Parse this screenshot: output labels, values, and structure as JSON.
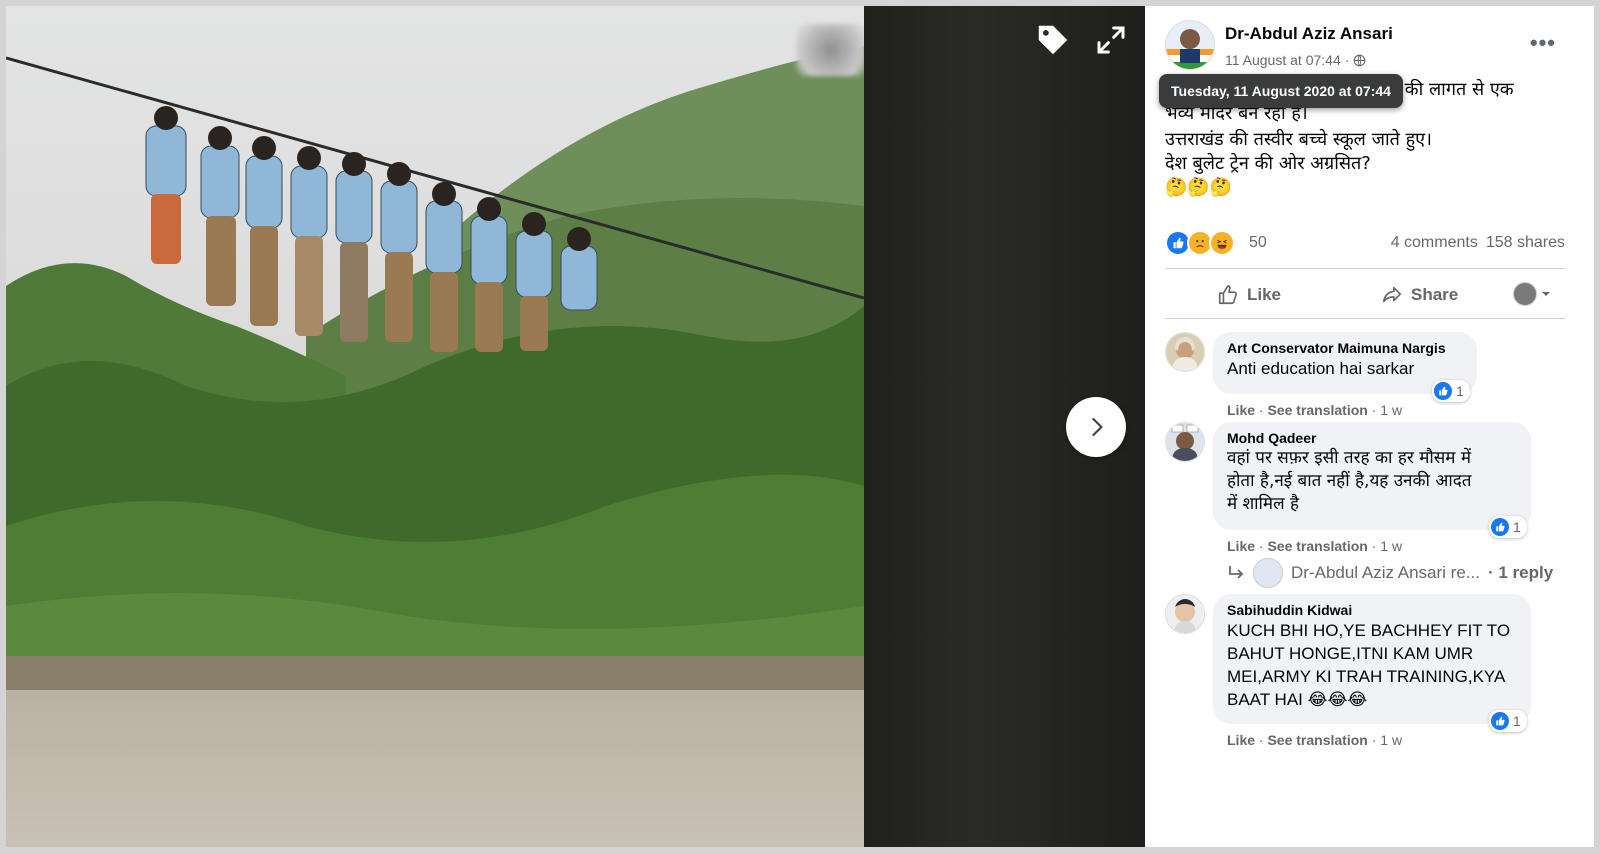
{
  "author": {
    "name": "Dr-Abdul Aziz Ansari",
    "time": "11 August at 07:44 ·",
    "tooltip": "Tuesday, 11 August 2020 at 07:44"
  },
  "post": {
    "lines": [
      "ये तस्वीर उसी देश की है जहां करोड़ों की लागत से एक",
      "भव्य मंदिर बन रहा है।",
      "उत्तराखंड की तस्वीर बच्चे स्कूल जाते हुए।",
      "देश बुलेट ट्रेन की ओर अग्रसित?",
      "🤔🤔🤔"
    ]
  },
  "stats": {
    "reaction_count": "50",
    "comments": "4 comments",
    "shares": "158 shares"
  },
  "actions": {
    "like_label": "Like",
    "share_label": "Share"
  },
  "comments": [
    {
      "name": "Art Conservator Maimuna Nargis",
      "text": [
        "Anti education hai sarkar"
      ],
      "like": "Like",
      "translate": "See translation",
      "age": "1 w",
      "likes": "1"
    },
    {
      "name": "Mohd Qadeer",
      "text": [
        "वहां पर सफ़र इसी तरह का हर मौसम में",
        "होता है,नई बात नहीं है,यह उनकी आदत",
        "में शामिल है"
      ],
      "like": "Like",
      "translate": "See translation",
      "age": "1 w",
      "likes": "1"
    },
    {
      "name": "Sabihuddin Kidwai",
      "text": [
        "KUCH BHI HO,YE BACHHEY FIT TO",
        "BAHUT HONGE,ITNI KAM UMR",
        "MEI,ARMY KI TRAH TRAINING,KYA",
        "BAAT HAI 😂😂😂"
      ],
      "like": "Like",
      "translate": "See translation",
      "age": "1 w",
      "likes": "1"
    }
  ],
  "reply": {
    "text": "Dr-Abdul Aziz Ansari re...",
    "count": "· 1 reply"
  },
  "separators": {
    "dot": "·"
  }
}
